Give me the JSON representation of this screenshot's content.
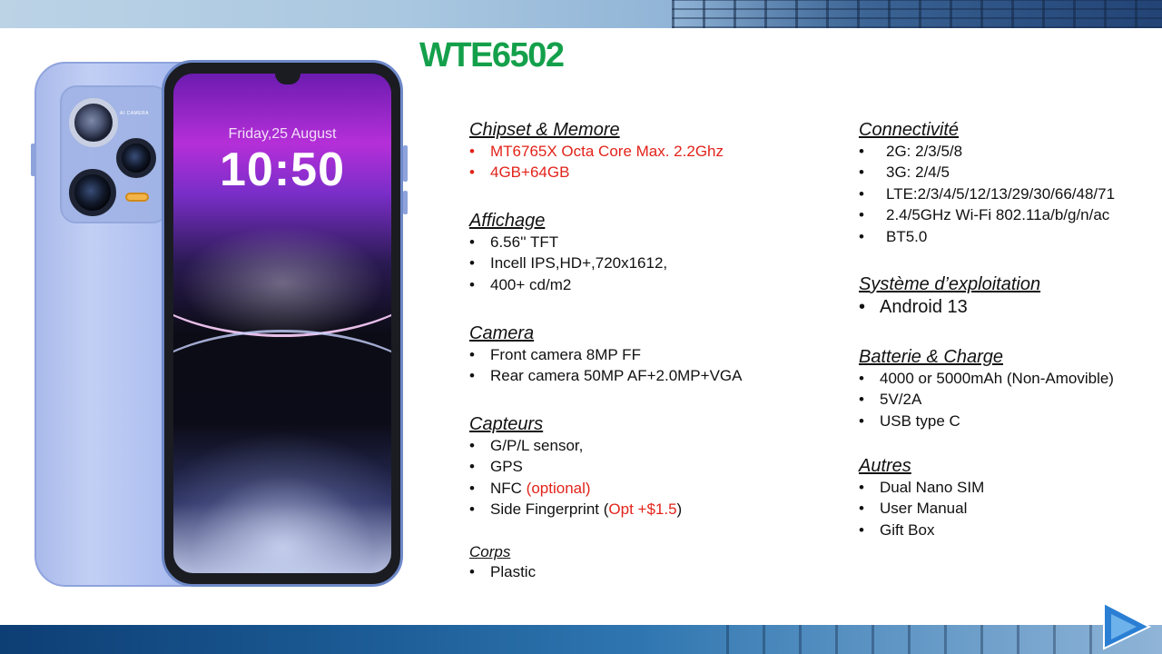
{
  "title": "WTE6502",
  "phone": {
    "date": "Friday,25 August",
    "time": "10:50",
    "camera_label": "AI CAMERA"
  },
  "left_column": [
    {
      "title": "Chipset & Memore",
      "items": [
        {
          "text": "MT6765X Octa Core Max.  2.2Ghz",
          "color": "red"
        },
        {
          "text": "4GB+64GB",
          "color": "red"
        }
      ]
    },
    {
      "title": "Affichage",
      "items": [
        {
          "text": "6.56'' TFT"
        },
        {
          "text": "Incell IPS,HD+,720x1612,"
        },
        {
          "text": "400+ cd/m2"
        }
      ]
    },
    {
      "title": "Camera",
      "items": [
        {
          "text": "Front camera 8MP FF"
        },
        {
          "text": "Rear camera  50MP AF+2.0MP+VGA"
        }
      ]
    },
    {
      "title": "Capteurs",
      "items": [
        {
          "text": "G/P/L sensor,"
        },
        {
          "text": "GPS"
        },
        {
          "text": "NFC ",
          "extra": "(optional)"
        },
        {
          "text": "Side Fingerprint  (",
          "extra": "Opt +$1.5",
          "suffix": ")"
        }
      ]
    },
    {
      "title": "Corps",
      "items": [
        {
          "text": " Plastic"
        }
      ]
    }
  ],
  "right_column": [
    {
      "title": "Connectivité",
      "items": [
        {
          "text": "2G: 2/3/5/8"
        },
        {
          "text": "3G: 2/4/5"
        },
        {
          "text": "LTE:2/3/4/5/12/13/29/30/66/48/71"
        },
        {
          "text": "2.4/5GHz  Wi-Fi 802.11a/b/g/n/ac"
        },
        {
          "text": "BT5.0"
        }
      ]
    },
    {
      "title": "Système d’exploitation",
      "items": [
        {
          "text": "Android 13"
        }
      ]
    },
    {
      "title": "Batterie & Charge",
      "items": [
        {
          "text": "4000 or 5000mAh (Non-Amovible)"
        },
        {
          "text": "5V/2A"
        },
        {
          "text": "USB type C"
        }
      ]
    },
    {
      "title": "Autres",
      "items": [
        {
          "text": "Dual Nano  SIM"
        },
        {
          "text": "User Manual"
        },
        {
          "text": "Gift Box"
        }
      ]
    }
  ],
  "bullet": "•",
  "colors": {
    "title_green": "#14a04b",
    "accent_red": "#e2231a",
    "banner_blue": "#1b5a94"
  },
  "icons": {
    "next_slide": "triangle-arrow-icon"
  }
}
